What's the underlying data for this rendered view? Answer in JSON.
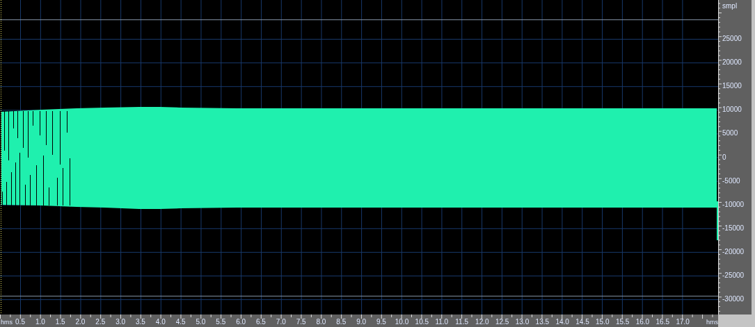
{
  "waveform_view": {
    "amplitude_ruler": {
      "unit": "smpl",
      "labels": [
        "25000",
        "20000",
        "15000",
        "10000",
        "5000",
        "0",
        "-5000",
        "-10000",
        "-15000",
        "-20000",
        "-25000",
        "-30000"
      ]
    },
    "time_ruler": {
      "start_unit": "hms",
      "end_unit": "hms",
      "labels": [
        "0.5",
        "1.0",
        "1.5",
        "2.0",
        "2.5",
        "3.0",
        "3.5",
        "4.0",
        "4.5",
        "5.0",
        "5.5",
        "6.0",
        "6.5",
        "7.0",
        "7.5",
        "8.0",
        "8.5",
        "9.0",
        "9.5",
        "10.0",
        "10.5",
        "11.0",
        "11.5",
        "12.0",
        "12.5",
        "13.0",
        "13.5",
        "14.0",
        "14.5",
        "15.0",
        "15.5",
        "16.0",
        "16.5",
        "17.0"
      ]
    }
  }
}
